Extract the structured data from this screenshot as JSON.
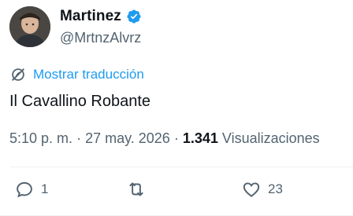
{
  "author": {
    "display_name": "Martinez",
    "handle": "@MrtnzAlvrz"
  },
  "translate": {
    "label": "Mostrar traducción"
  },
  "tweet": {
    "text": "Il Cavallino Robante"
  },
  "meta": {
    "time": "5:10 p. m.",
    "separator": "·",
    "date": "27 may. 2026",
    "views_count": "1.341",
    "views_label": "Visualizaciones"
  },
  "actions": {
    "reply_count": "1",
    "retweet_count": "",
    "like_count": "23"
  },
  "colors": {
    "accent": "#1d9bf0",
    "muted": "#536471",
    "text": "#0f1419"
  },
  "icons": [
    "verified-badge-icon",
    "translate-icon",
    "reply-icon",
    "retweet-icon",
    "like-icon"
  ]
}
